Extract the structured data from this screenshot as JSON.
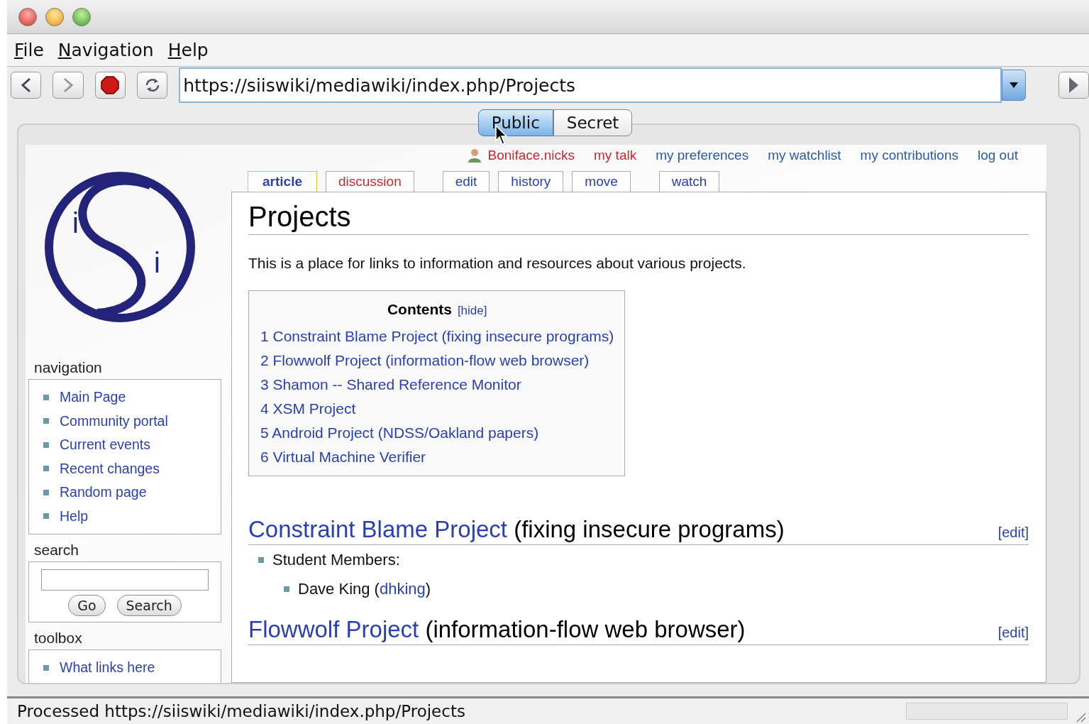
{
  "menu": [
    "File",
    "Navigation",
    "Help"
  ],
  "address": "https://siiswiki/mediawiki/index.php/Projects",
  "mode_tabs": [
    {
      "label": "Public",
      "selected": true
    },
    {
      "label": "Secret",
      "selected": false
    }
  ],
  "user_links": [
    {
      "label": "Boniface.nicks",
      "kind": "user",
      "new": true
    },
    {
      "label": "my talk",
      "kind": "link",
      "new": true
    },
    {
      "label": "my preferences",
      "kind": "link",
      "new": false
    },
    {
      "label": "my watchlist",
      "kind": "link",
      "new": false
    },
    {
      "label": "my contributions",
      "kind": "link",
      "new": false
    },
    {
      "label": "log out",
      "kind": "link",
      "new": false
    }
  ],
  "page_tabs": [
    {
      "label": "article",
      "selected": true,
      "new": false
    },
    {
      "label": "discussion",
      "selected": false,
      "new": true
    },
    {
      "label": "edit",
      "selected": false,
      "new": false
    },
    {
      "label": "history",
      "selected": false,
      "new": false
    },
    {
      "label": "move",
      "selected": false,
      "new": false
    },
    {
      "label": "watch",
      "selected": false,
      "new": false
    }
  ],
  "logo": {
    "letters": [
      "i",
      "i"
    ]
  },
  "sidebar": {
    "navigation": {
      "title": "navigation",
      "items": [
        "Main Page",
        "Community portal",
        "Current events",
        "Recent changes",
        "Random page",
        "Help"
      ]
    },
    "search": {
      "title": "search",
      "buttons": [
        "Go",
        "Search"
      ]
    },
    "toolbox": {
      "title": "toolbox",
      "items": [
        "What links here"
      ]
    }
  },
  "article": {
    "title": "Projects",
    "intro": "This is a place for links to information and resources about various projects.",
    "toc": {
      "title": "Contents",
      "toggle": "[hide]",
      "items": [
        {
          "number": "1",
          "text": "Constraint Blame Project (fixing insecure programs)"
        },
        {
          "number": "2",
          "text": "Flowwolf Project (information-flow web browser)"
        },
        {
          "number": "3",
          "text": "Shamon -- Shared Reference Monitor"
        },
        {
          "number": "4",
          "text": "XSM Project"
        },
        {
          "number": "5",
          "text": "Android Project (NDSS/Oakland papers)"
        },
        {
          "number": "6",
          "text": "Virtual Machine Verifier"
        }
      ]
    },
    "sections": [
      {
        "link": "Constraint Blame Project",
        "rest": "(fixing insecure programs)",
        "edit": "[edit]",
        "list_label": "Student Members:",
        "members": [
          {
            "before": "Dave King (",
            "user": "dhking",
            "after": ")"
          }
        ]
      },
      {
        "link": "Flowwolf Project",
        "rest": "(information-flow web browser)",
        "edit": "[edit]"
      }
    ]
  },
  "status": "Processed https://siiswiki/mediawiki/index.php/Projects"
}
